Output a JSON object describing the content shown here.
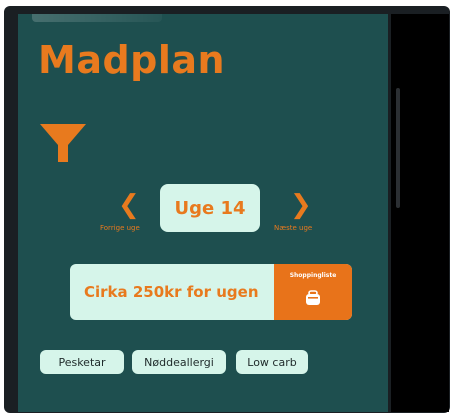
{
  "app": {
    "title": "Madplan"
  },
  "filter": {
    "icon": "filter-icon"
  },
  "week": {
    "current_label": "Uge 14",
    "prev_caption": "Forrige uge",
    "next_caption": "Næste uge",
    "prev_icon": "chevron-left-icon",
    "next_icon": "chevron-right-icon"
  },
  "budget": {
    "text": "Cirka 250kr for ugen",
    "shopping_label": "Shoppingliste",
    "shopping_icon": "shopping-basket-icon"
  },
  "tags": [
    {
      "label": "Pesketar"
    },
    {
      "label": "Nøddeallergi"
    },
    {
      "label": "Low carb"
    }
  ],
  "colors": {
    "background": "#1e4f4f",
    "accent": "#e87a1e",
    "chip": "#d6f5ea"
  }
}
